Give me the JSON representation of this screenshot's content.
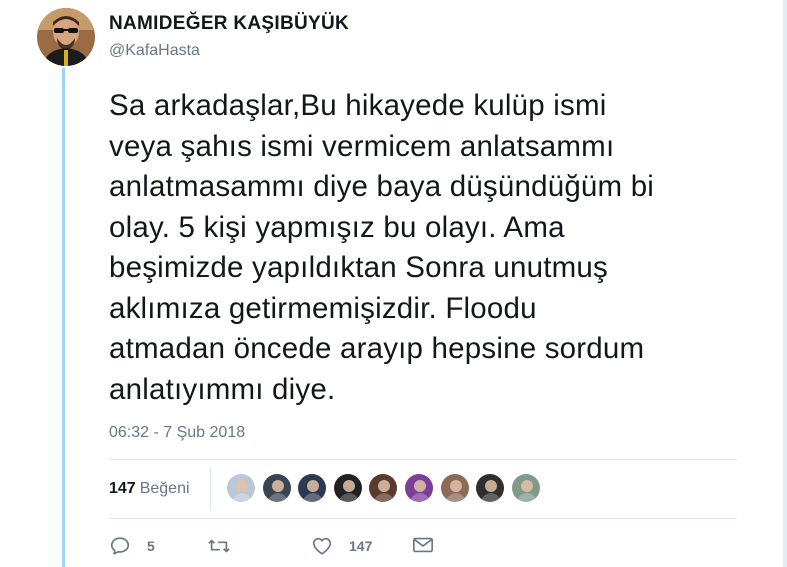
{
  "tweet": {
    "display_name": "NAMIDEĞER KAŞIBÜYÜK",
    "handle": "@KafaHasta",
    "text": "Sa arkadaşlar,Bu hikayede kulüp ismi\nveya şahıs ismi vermicem anlatsammı\nanlatmasammı diye baya düşündüğüm bi\nolay. 5 kişi yapmışız bu olayı. Ama\nbeşimizde yapıldıktan Sonra unutmuş\naklımıza getirmemişizdir. Floodu\natmadan öncede arayıp hepsine sordum\nanlatıyımmı diye.",
    "timestamp": "06:32 - 7 Şub 2018"
  },
  "stats": {
    "likes_count": "147",
    "likes_label": "Beğeni"
  },
  "likers": [
    {
      "name": "liker-avatar-1",
      "color": "#b9c7d6"
    },
    {
      "name": "liker-avatar-2",
      "color": "#3b4453"
    },
    {
      "name": "liker-avatar-3",
      "color": "#2b3a52"
    },
    {
      "name": "liker-avatar-4",
      "color": "#222222"
    },
    {
      "name": "liker-avatar-5",
      "color": "#5a3b2e"
    },
    {
      "name": "liker-avatar-6",
      "color": "#7b3f9a"
    },
    {
      "name": "liker-avatar-7",
      "color": "#8c6a5a"
    },
    {
      "name": "liker-avatar-8",
      "color": "#2f2f2f"
    },
    {
      "name": "liker-avatar-9",
      "color": "#7f9a8a"
    }
  ],
  "actions": {
    "reply_icon": "reply-icon",
    "reply_count": "5",
    "retweet_icon": "retweet-icon",
    "like_icon": "heart-icon",
    "like_count": "147",
    "message_icon": "envelope-icon"
  },
  "colors": {
    "thread_line": "#9fd3f5",
    "secondary_text": "#657786",
    "primary_text": "#14171a"
  }
}
